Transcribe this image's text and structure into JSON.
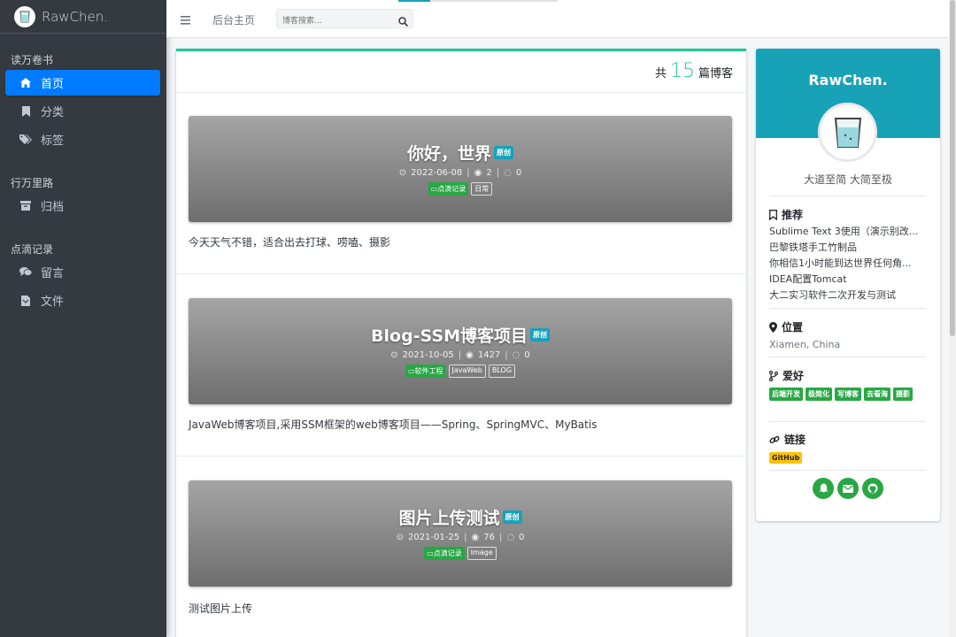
{
  "brand": {
    "name": "RawChen."
  },
  "sidebar": {
    "sections": [
      {
        "header": "读万卷书",
        "items": [
          {
            "label": "首页",
            "icon": "home-icon",
            "active": true
          },
          {
            "label": "分类",
            "icon": "bookmark-icon"
          },
          {
            "label": "标签",
            "icon": "tags-icon"
          }
        ]
      },
      {
        "header": "行万里路",
        "items": [
          {
            "label": "归档",
            "icon": "archive-icon"
          }
        ]
      },
      {
        "header": "点滴记录",
        "items": [
          {
            "label": "留言",
            "icon": "comments-icon"
          },
          {
            "label": "文件",
            "icon": "file-icon"
          }
        ]
      }
    ]
  },
  "topbar": {
    "menu_icon": "bars-icon",
    "home_link": "后台主页",
    "search_placeholder": "博客搜索...",
    "search_icon": "search-icon"
  },
  "blog_count": {
    "prefix": "共",
    "count": "15",
    "suffix": "篇博客"
  },
  "posts": [
    {
      "title": "你好，世界",
      "badge": "原创",
      "date": "2022-06-08",
      "views": "2",
      "comments": "0",
      "category": "点滴记录",
      "tags": [
        "日常"
      ],
      "summary": "今天天气不错，适合出去打球、唠嗑、摄影"
    },
    {
      "title": "Blog-SSM博客项目",
      "badge": "原创",
      "date": "2021-10-05",
      "views": "1427",
      "comments": "0",
      "category": "软件工程",
      "tags": [
        "JavaWeb",
        "BLOG"
      ],
      "summary": "JavaWeb博客项目,采用SSM框架的web博客项目——Spring、SpringMVC、MyBatis"
    },
    {
      "title": "图片上传测试",
      "badge": "原创",
      "date": "2021-01-25",
      "views": "76",
      "comments": "0",
      "category": "点滴记录",
      "tags": [
        "Image"
      ],
      "summary": "测试图片上传"
    }
  ],
  "profile": {
    "name": "RawChen.",
    "motto": "大道至简 大简至极",
    "recommend_title": "推荐",
    "recommend": [
      "Sublime Text 3使用（演示别改...",
      "巴黎铁塔手工竹制品",
      "你相信1小时能到达世界任何角...",
      "IDEA配置Tomcat",
      "大二实习软件二次开发与测试"
    ],
    "location_title": "位置",
    "location": "Xiamen, China",
    "hobby_title": "爱好",
    "hobbies": [
      "后端开发",
      "极简化",
      "写博客",
      "去看海",
      "摄影"
    ],
    "links_title": "链接",
    "links": [
      "GitHub"
    ],
    "social": [
      "qq-icon",
      "email-icon",
      "github-icon"
    ]
  },
  "colors": {
    "sidebar_bg": "#343a40",
    "active_nav": "#007bff",
    "accent_teal": "#20c997",
    "profile_header": "#17a2b8",
    "green_badge": "#28a745",
    "yellow_badge": "#ffc107"
  }
}
